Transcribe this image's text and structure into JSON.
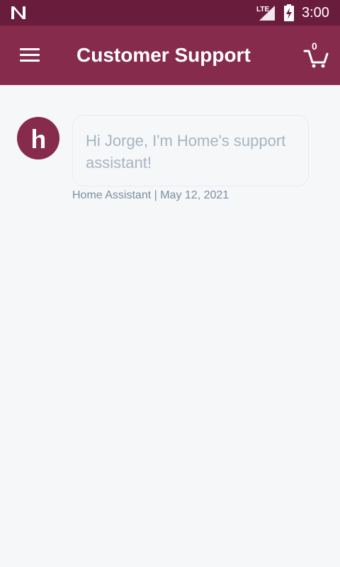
{
  "status_bar": {
    "time": "3:00",
    "network": "LTE",
    "icons": [
      "n-logo-icon",
      "lte-signal-icon",
      "battery-charging-icon"
    ]
  },
  "header": {
    "title": "Customer Support",
    "cart_count": "0",
    "icons": [
      "menu-icon",
      "cart-icon"
    ]
  },
  "chat": {
    "messages": [
      {
        "text": "Hi Jorge, I'm Home's support assistant!",
        "sender": "Home Assistant",
        "separator": "|",
        "date": "May 12, 2021",
        "avatar_icon": "home-logo-icon"
      }
    ]
  },
  "colors": {
    "status_bar": "#6a1c3d",
    "app_bar": "#872b4d",
    "background": "#f6f7f9",
    "message_text": "#a8b4bf",
    "meta_text": "#7a8e9e"
  }
}
